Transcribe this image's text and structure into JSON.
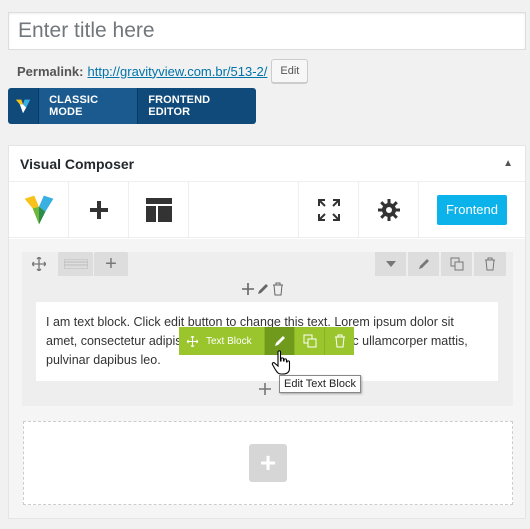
{
  "title_input": {
    "placeholder": "Enter title here"
  },
  "permalink": {
    "label": "Permalink:",
    "url": "http://gravityview.com.br/513-2/",
    "edit_label": "Edit"
  },
  "mode_bar": {
    "classic_label": "CLASSIC MODE",
    "frontend_label": "FRONTEND EDITOR"
  },
  "panel": {
    "title": "Visual Composer",
    "toggle_icon": "triangle-up-icon",
    "frontend_button": "Frontend"
  },
  "text_block": {
    "content": "I am text block. Click edit button to change this text. Lorem ipsum dolor sit amet, consectetur adipiscing elit. Ut elit tellus, luctus nec ullamcorper mattis, pulvinar dapibus leo."
  },
  "element_toolbar": {
    "label": "Text Block"
  },
  "tooltip": {
    "text": "Edit Text Block"
  },
  "colors": {
    "mode_bar": "#0f4a7a",
    "frontend_button": "#0cb3ea",
    "element_toolbar": "#9ac52c"
  }
}
